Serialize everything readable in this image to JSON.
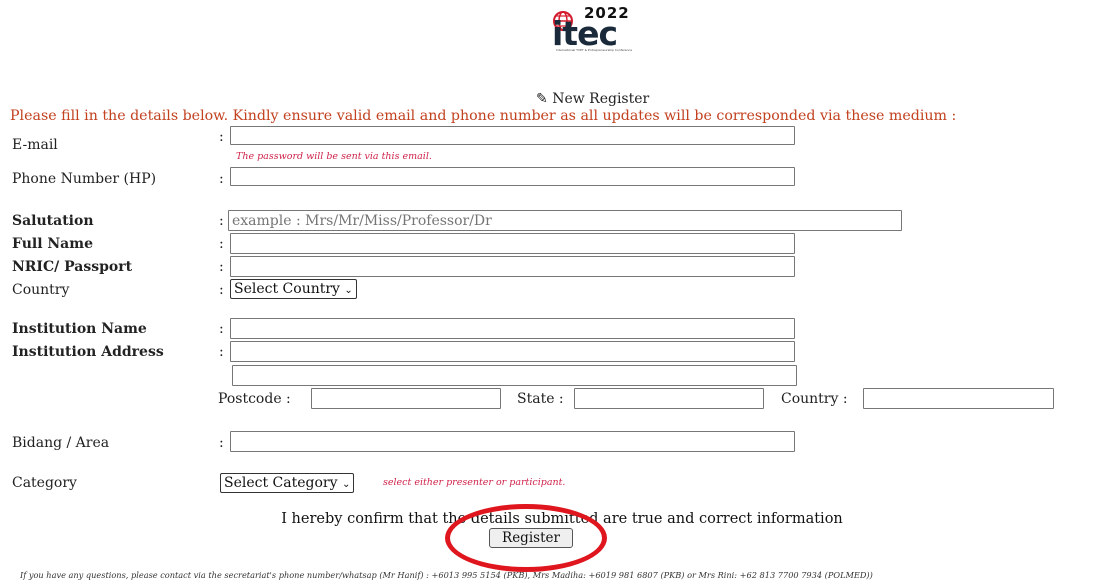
{
  "logo": {
    "year": "2022",
    "word": "itec",
    "subtitle": "International TVET & Entrepreneurship Conference"
  },
  "header": {
    "title": "New Register",
    "notice": "Please fill in the details below. Kindly ensure valid email and phone number as all updates will be corresponded via these medium :"
  },
  "form": {
    "colon": ":",
    "email": {
      "label": "E-mail",
      "value": "",
      "hint": "The password will be sent via this email."
    },
    "phone": {
      "label": "Phone Number (HP)",
      "value": ""
    },
    "salutation": {
      "label": "Salutation",
      "placeholder": "example : Mrs/Mr/Miss/Professor/Dr"
    },
    "full_name": {
      "label": "Full Name",
      "value": ""
    },
    "nric": {
      "label": "NRIC/ Passport",
      "value": ""
    },
    "country": {
      "label": "Country",
      "selected": "Select Country"
    },
    "institution_name": {
      "label": "Institution Name",
      "value": ""
    },
    "institution_address": {
      "label": "Institution Address",
      "value": ""
    },
    "postcode": {
      "label": "Postcode :"
    },
    "state": {
      "label": "State :"
    },
    "address_country": {
      "label": "Country :"
    },
    "area": {
      "label": "Bidang / Area",
      "value": ""
    },
    "category": {
      "label": "Category",
      "selected": "Select Category",
      "hint": "select either presenter or participant."
    }
  },
  "confirm_text": "I hereby confirm that the details submitted are true and correct information",
  "register_button": "Register",
  "footer": "If you have any questions, please contact via the secretariat's phone number/whatsap (Mr Hanif) : +6013 995 5154 (PKB), Mrs Madiha: +6019 981 6807 (PKB) or Mrs Rini: +62 813 7700 7934 (POLMED))",
  "colors": {
    "notice": "#c2411f",
    "hint": "#d0234b",
    "highlight_circle": "#e0161e"
  }
}
